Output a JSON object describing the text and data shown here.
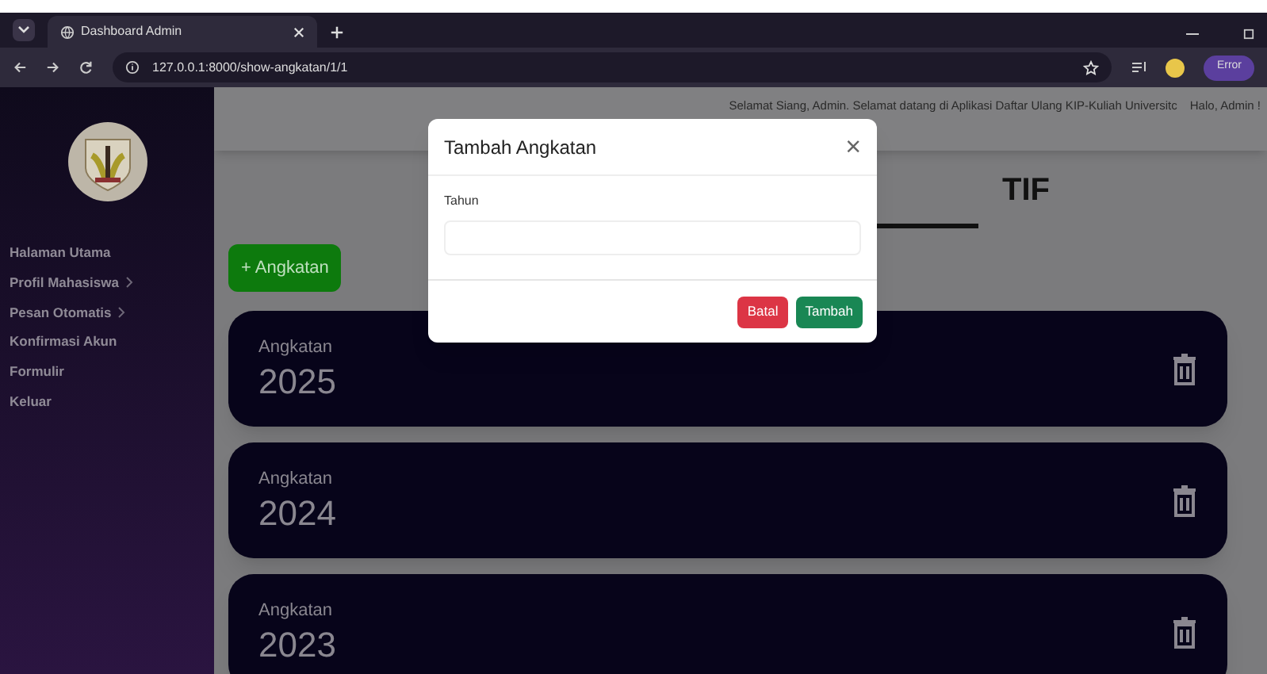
{
  "browser": {
    "tab_title": "Dashboard Admin",
    "url": "127.0.0.1:8000/show-angkatan/1/1",
    "profile_button": "Error"
  },
  "sidebar": {
    "items": [
      {
        "label": "Halaman Utama",
        "has_submenu": false
      },
      {
        "label": "Profil Mahasiswa",
        "has_submenu": true
      },
      {
        "label": "Pesan Otomatis",
        "has_submenu": true
      },
      {
        "label": "Konfirmasi Akun",
        "has_submenu": false
      },
      {
        "label": "Formulir",
        "has_submenu": false
      },
      {
        "label": "Keluar",
        "has_submenu": false
      }
    ]
  },
  "header": {
    "marquee": "Selamat Siang, Admin. Selamat datang di Aplikasi Daftar Ulang KIP-Kuliah Universitc",
    "greeting": "Halo, Admin !"
  },
  "page_title": "TIF",
  "add_button": "+ Angkatan",
  "cards": [
    {
      "label": "Angkatan",
      "year": "2025"
    },
    {
      "label": "Angkatan",
      "year": "2024"
    },
    {
      "label": "Angkatan",
      "year": "2023"
    }
  ],
  "modal": {
    "title": "Tambah Angkatan",
    "close": "×",
    "field_label": "Tahun",
    "buttons": [
      {
        "label": "Batal",
        "kind": "cancel"
      },
      {
        "label": "Tambah",
        "kind": "submit"
      }
    ]
  }
}
